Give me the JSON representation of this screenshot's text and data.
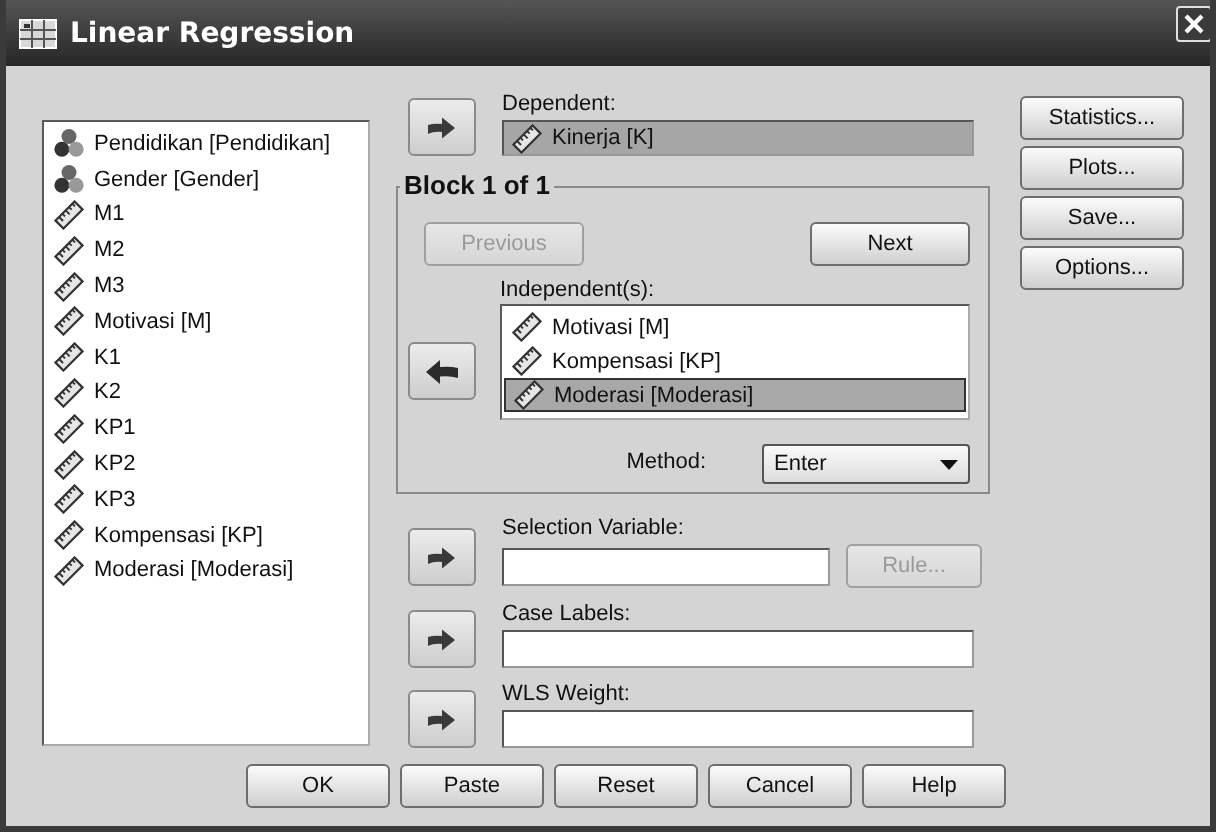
{
  "window": {
    "title": "Linear Regression"
  },
  "variables": [
    {
      "name": "Pendidikan [Pendidikan]",
      "kind": "nominal",
      "selected": false
    },
    {
      "name": "Gender [Gender]",
      "kind": "nominal",
      "selected": false
    },
    {
      "name": "M1",
      "kind": "scale",
      "selected": false
    },
    {
      "name": "M2",
      "kind": "scale",
      "selected": false
    },
    {
      "name": "M3",
      "kind": "scale",
      "selected": false
    },
    {
      "name": "Motivasi [M]",
      "kind": "scale",
      "selected": false
    },
    {
      "name": "K1",
      "kind": "scale",
      "selected": false
    },
    {
      "name": "K2",
      "kind": "scale",
      "selected": false
    },
    {
      "name": "KP1",
      "kind": "scale",
      "selected": false
    },
    {
      "name": "KP2",
      "kind": "scale",
      "selected": false
    },
    {
      "name": "KP3",
      "kind": "scale",
      "selected": false
    },
    {
      "name": "Kompensasi [KP]",
      "kind": "scale",
      "selected": false
    },
    {
      "name": "Moderasi [Moderasi]",
      "kind": "scale",
      "selected": false
    }
  ],
  "dependent": {
    "label": "Dependent:",
    "value": "Kinerja [K]",
    "kind": "scale"
  },
  "block": {
    "title": "Block 1 of 1",
    "previous": {
      "label": "Previous",
      "disabled": true
    },
    "next": {
      "label": "Next",
      "disabled": false
    },
    "independents_label": "Independent(s):",
    "independents": [
      {
        "name": "Motivasi [M]",
        "kind": "scale",
        "selected": false
      },
      {
        "name": "Kompensasi [KP]",
        "kind": "scale",
        "selected": false
      },
      {
        "name": "Moderasi [Moderasi]",
        "kind": "scale",
        "selected": true
      }
    ],
    "method": {
      "label": "Method:",
      "value": "Enter"
    }
  },
  "selection_variable": {
    "label": "Selection Variable:",
    "rule": {
      "label": "Rule...",
      "disabled": true
    }
  },
  "case_labels": {
    "label": "Case Labels:"
  },
  "wls_weight": {
    "label": "WLS Weight:"
  },
  "side_buttons": [
    "Statistics...",
    "Plots...",
    "Save...",
    "Options..."
  ],
  "buttons": [
    "OK",
    "Paste",
    "Reset",
    "Cancel",
    "Help"
  ]
}
